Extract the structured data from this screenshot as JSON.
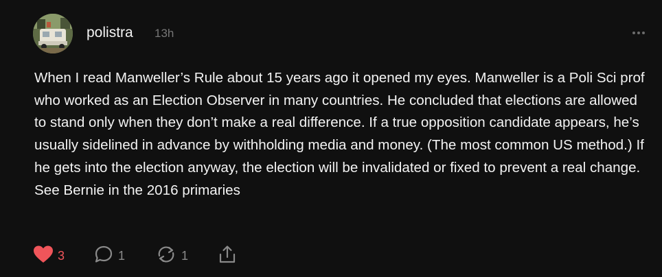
{
  "post": {
    "author": "polistra",
    "timestamp": "13h",
    "body": "When I read Manweller’s Rule about 15 years ago it opened my eyes. Manweller is a Poli Sci prof who worked as an Election Observer in many countries. He concluded that elections are allowed to stand only when they don’t make a real difference. If a true opposition candidate appears, he’s usually sidelined in advance by withholding media and money. (The most common US method.) If he gets into the election anyway, the election will be invalidated or fixed to prevent a real change. See Bernie in the 2016 primaries",
    "more_icon": "more-horizontal-icon"
  },
  "actions": {
    "like": {
      "icon": "heart-icon",
      "count": "3",
      "color": "#f0555a"
    },
    "reply": {
      "icon": "comment-icon",
      "count": "1"
    },
    "repost": {
      "icon": "repost-icon",
      "count": "1"
    },
    "share": {
      "icon": "share-icon"
    }
  },
  "colors": {
    "background": "#101010",
    "text": "#f3f3f3",
    "muted": "#777777",
    "accent": "#f0555a"
  }
}
